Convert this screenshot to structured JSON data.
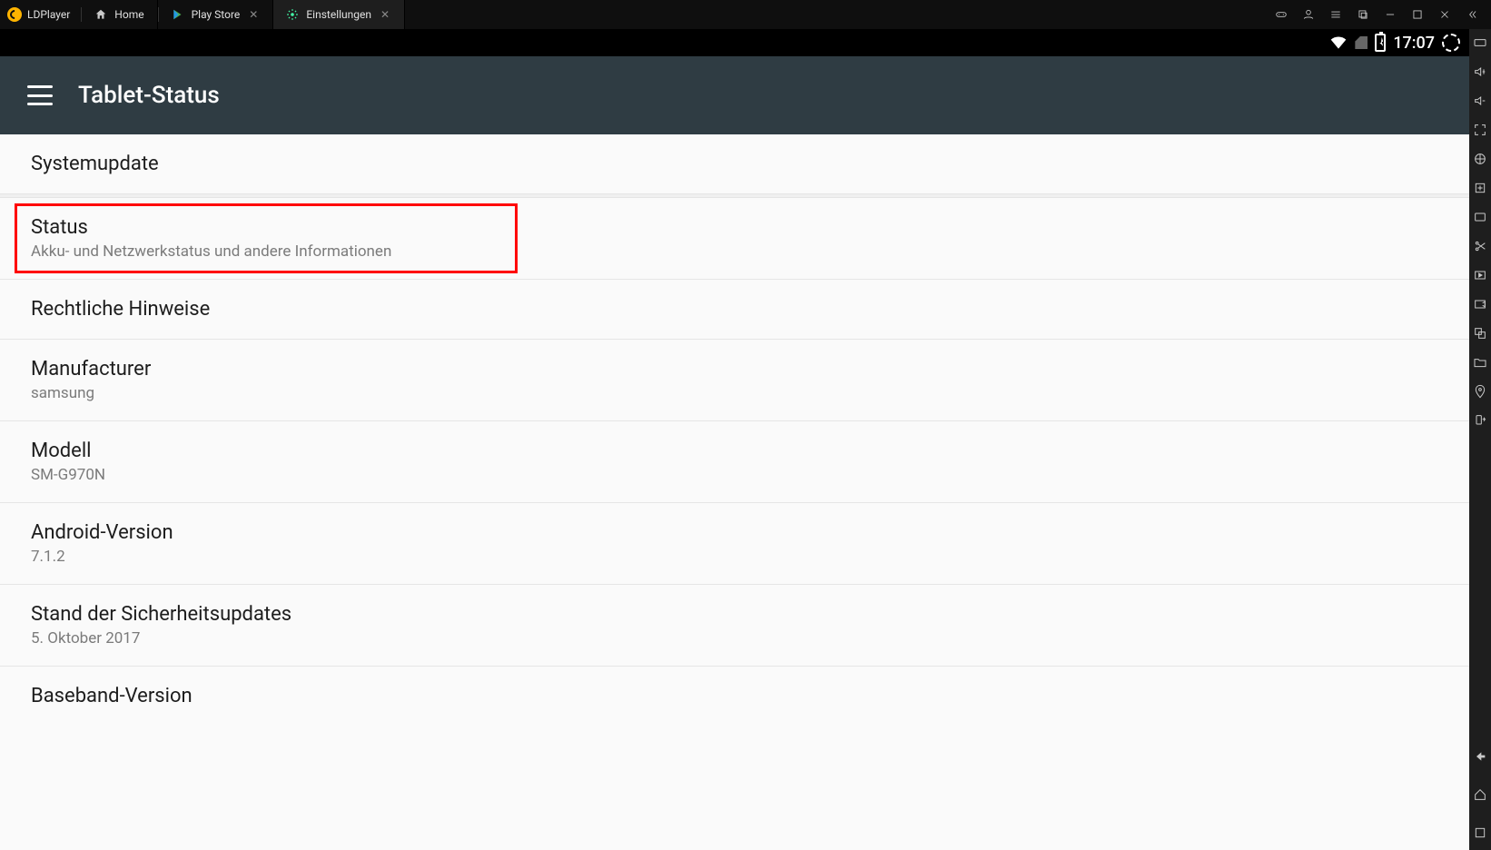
{
  "app": {
    "brand": "LDPlayer"
  },
  "tabs": [
    {
      "label": "Home",
      "closable": false
    },
    {
      "label": "Play Store",
      "closable": true
    },
    {
      "label": "Einstellungen",
      "closable": true,
      "active": true
    }
  ],
  "statusbar": {
    "time": "17:07"
  },
  "appbar": {
    "title": "Tablet-Status"
  },
  "rows": [
    {
      "title": "Systemupdate",
      "subtitle": ""
    },
    {
      "title": "Status",
      "subtitle": "Akku- und Netzwerkstatus und andere Informationen",
      "highlight": true
    },
    {
      "title": "Rechtliche Hinweise",
      "subtitle": ""
    },
    {
      "title": "Manufacturer",
      "subtitle": "samsung"
    },
    {
      "title": "Modell",
      "subtitle": "SM-G970N"
    },
    {
      "title": "Android-Version",
      "subtitle": "7.1.2"
    },
    {
      "title": "Stand der Sicherheitsupdates",
      "subtitle": "5. Oktober 2017"
    },
    {
      "title": "Baseband-Version",
      "subtitle": ""
    }
  ],
  "icons": {
    "home": "home-icon",
    "play": "play-store-icon",
    "settings": "settings-gear-icon",
    "gamepad": "gamepad-icon",
    "user": "user-icon",
    "menu": "menu-icon",
    "multi": "multi-window-icon",
    "minimize": "minimize-icon",
    "maximize": "maximize-icon",
    "close": "close-icon",
    "collapse": "collapse-icon"
  }
}
